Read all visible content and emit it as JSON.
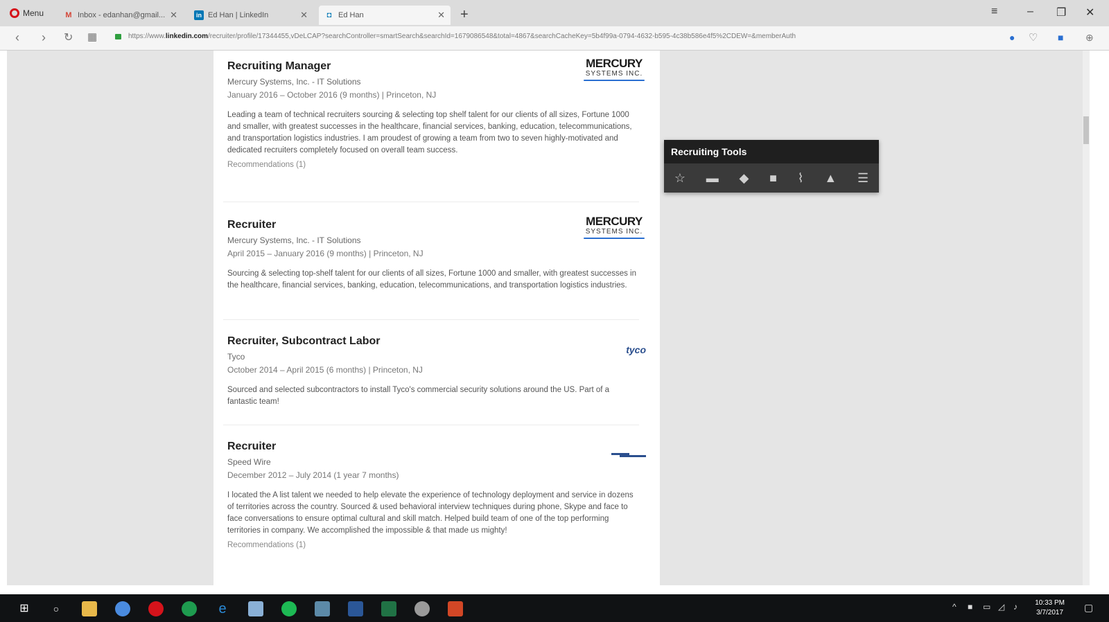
{
  "browser": {
    "menu_label": "Menu",
    "tabs": [
      {
        "label": "Inbox - edanhan@gmail...",
        "icon": "gmail-icon"
      },
      {
        "label": "Ed Han | LinkedIn",
        "icon": "linkedin-icon"
      },
      {
        "label": "Ed Han",
        "icon": "linkedin-recruiter-icon"
      }
    ],
    "url_prefix": "https://www.",
    "url_domain": "linkedin.com",
    "url_path": "/recruiter/profile/17344455,vDeLCAP?searchController=smartSearch&searchId=1679086548&total=4867&searchCacheKey=5b4f99a-0794-4632-b595-4c38b586e4f5%2CDEW=&memberAuth"
  },
  "entries": [
    {
      "title": "Recruiting Manager",
      "company": "Mercury Systems, Inc. - IT Solutions",
      "dates": "January 2016 – October 2016 (9 months) | Princeton, NJ",
      "description": "Leading a team of technical recruiters sourcing & selecting top shelf talent for our clients of all sizes, Fortune 1000 and smaller, with greatest successes in the healthcare, financial services, banking, education, telecommunications, and transportation logistics industries. I am proudest of growing a team from two to seven highly-motivated and dedicated recruiters completely focused on overall team success.",
      "recommendations": "Recommendations (1)",
      "logo_line1": "MERCURY",
      "logo_line2": "SYSTEMS INC."
    },
    {
      "title": "Recruiter",
      "company": "Mercury Systems, Inc. - IT Solutions",
      "dates": "April 2015 – January 2016 (9 months) | Princeton, NJ",
      "description": "Sourcing & selecting top-shelf talent for our clients of all sizes, Fortune 1000 and smaller, with greatest successes in the healthcare, financial services, banking, education, telecommunications, and transportation logistics industries.",
      "logo_line1": "MERCURY",
      "logo_line2": "SYSTEMS INC."
    },
    {
      "title": "Recruiter, Subcontract Labor",
      "company": "Tyco",
      "dates": "October 2014 – April 2015 (6 months) | Princeton, NJ",
      "description": "Sourced and selected subcontractors to install Tyco's commercial security solutions around the US. Part of a fantastic team!",
      "logo": "tyco"
    },
    {
      "title": "Recruiter",
      "company": "Speed Wire",
      "dates": "December 2012 – July 2014 (1 year 7 months)",
      "description": "I located the A list talent we needed to help elevate the experience of technology deployment and service in dozens of territories across the country. Sourced & used behavioral interview techniques during phone, Skype and face to face conversations to ensure optimal cultural and skill match. Helped build team of one of the top performing territories in company. We accomplished the impossible & that made us mighty!",
      "recommendations": "Recommendations (1)"
    }
  ],
  "recruiting_tools": {
    "title": "Recruiting Tools",
    "icons": [
      "star-icon",
      "folder-icon",
      "tag-icon",
      "note-icon",
      "attachment-icon",
      "bell-icon",
      "menu-icon"
    ]
  },
  "taskbar": {
    "time": "10:33 PM",
    "date": "3/7/2017"
  }
}
